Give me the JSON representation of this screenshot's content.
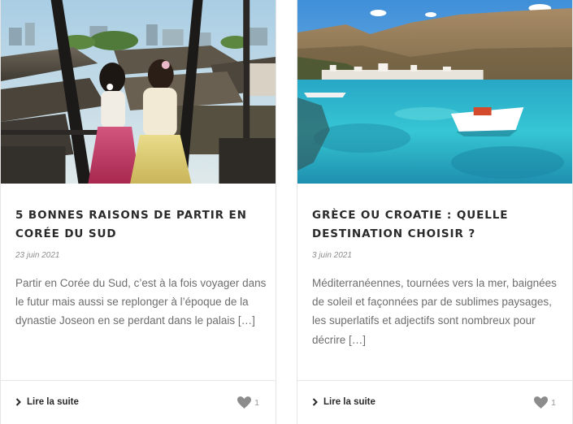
{
  "posts": [
    {
      "title": "5 bonnes raisons de partir en Corée du Sud",
      "date": "23 juin 2021",
      "excerpt": "Partir en Corée du Sud, c’est à la fois voyager dans le futur mais aussi se replonger à l’époque de la dynastie Joseon en se perdant dans le palais […]",
      "read_more": "Lire la suite",
      "likes": "1",
      "image_alt": "Two women in traditional hanbok looking over Seoul rooftops"
    },
    {
      "title": "Grèce ou Croatie : quelle destination choisir ?",
      "date": "3 juin 2021",
      "excerpt": "Méditerranéennes, tournées vers la mer, baignées de soleil et façonnées par de sublimes paysages, les superlatifs et adjectifs sont nombreux pour décrire […]",
      "read_more": "Lire la suite",
      "likes": "1",
      "image_alt": "Turquoise bay with a small white boat below a mountain village"
    }
  ],
  "icons": {
    "read_more": "chevron-right-icon",
    "like": "heart-icon"
  },
  "colors": {
    "title": "#2a2a2a",
    "text": "#6e6e6e",
    "meta": "#8d8d8d",
    "heart": "#8c8c8c",
    "border": "#e5e5e5"
  }
}
